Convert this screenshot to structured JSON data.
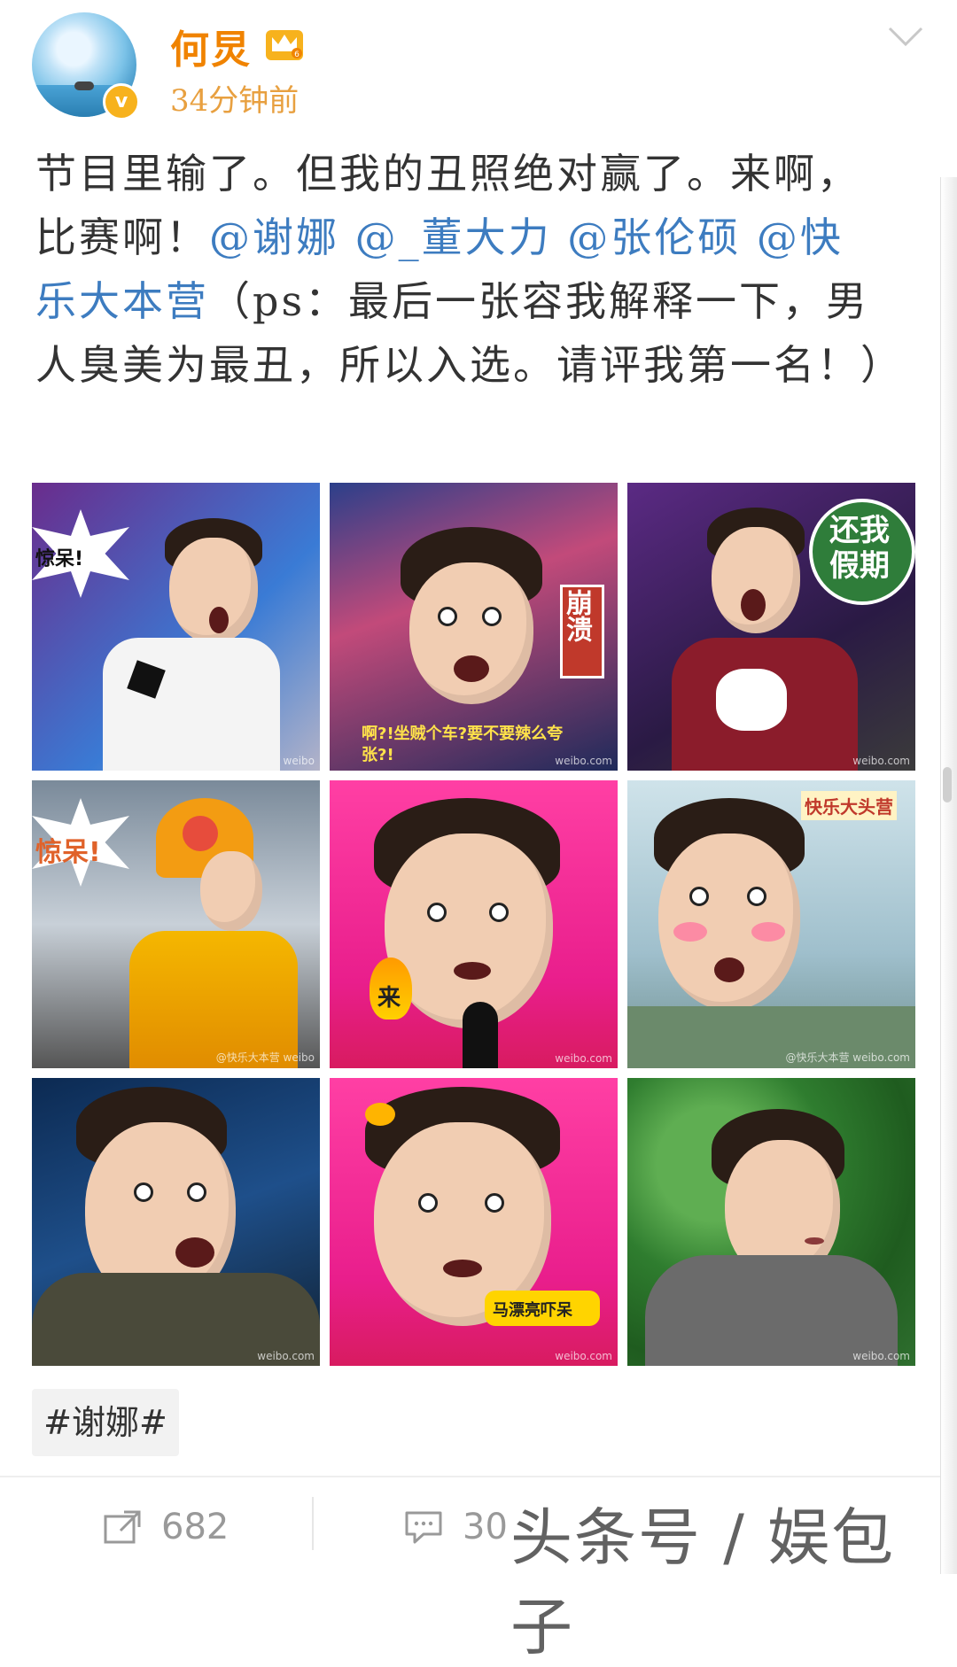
{
  "header": {
    "username": "何炅",
    "time_ago": "34分钟前",
    "verified_icon": "v-verified-icon",
    "member_icon": "crown-member-icon"
  },
  "post": {
    "text_parts": [
      "节目里输了。但我的丑照绝对赢了。来啊，比赛啊！",
      "@谢娜",
      " ",
      "@_董大力",
      " ",
      "@张伦硕",
      " ",
      "@快乐大本营",
      "（ps：最后一张容我解释一下，男人臭美为最丑，所以入选。请评我第一名！）"
    ]
  },
  "images": [
    {
      "caption": "惊呆!",
      "wm": "weibo"
    },
    {
      "caption": "崩溃",
      "subtitle": "啊?!坐贼个车?要不要辣么夸张?!",
      "wm": "weibo.com"
    },
    {
      "caption": "还我假期",
      "wm": "weibo.com"
    },
    {
      "caption": "惊呆!",
      "wm": "@快乐大本营 weibo"
    },
    {
      "caption": "来",
      "wm": "weibo.com"
    },
    {
      "caption": "快乐大头营",
      "wm": "@快乐大本营 weibo.com"
    },
    {
      "caption": "",
      "wm": "weibo.com"
    },
    {
      "caption": "马漂亮吓呆",
      "wm": "weibo.com"
    },
    {
      "caption": "",
      "wm": "weibo.com"
    }
  ],
  "hashtag": "#谢娜#",
  "actions": {
    "repost_count": "682",
    "comment_count": "30"
  },
  "watermark": "头条号 / 娱包子",
  "colors": {
    "username": "#f08300",
    "mention": "#3d7cc0",
    "verified": "#f7b21d"
  }
}
